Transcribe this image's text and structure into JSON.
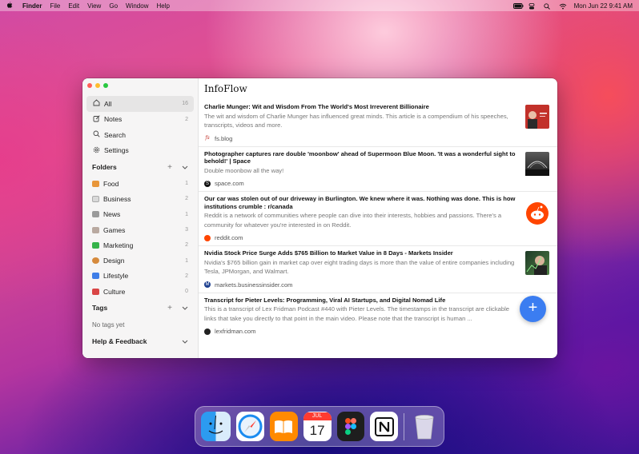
{
  "menubar": {
    "app_name": "Finder",
    "menus": [
      "File",
      "Edit",
      "View",
      "Go",
      "Window",
      "Help"
    ],
    "clock": "Mon Jun 22  9:41 AM"
  },
  "sidebar": {
    "nav": [
      {
        "label": "All",
        "count": "16",
        "icon": "home-icon"
      },
      {
        "label": "Notes",
        "count": "2",
        "icon": "notes-icon"
      },
      {
        "label": "Search",
        "count": "",
        "icon": "search-icon"
      },
      {
        "label": "Settings",
        "count": "",
        "icon": "gear-icon"
      }
    ],
    "folders_heading": "Folders",
    "folders": [
      {
        "label": "Food",
        "count": "1",
        "color": "#e8963a"
      },
      {
        "label": "Business",
        "count": "2",
        "color": "#c9c9c9"
      },
      {
        "label": "News",
        "count": "1",
        "color": "#9a9a9a"
      },
      {
        "label": "Games",
        "count": "3",
        "color": "#b9a9a0"
      },
      {
        "label": "Marketing",
        "count": "2",
        "color": "#35b34a"
      },
      {
        "label": "Design",
        "count": "1",
        "color": "#d68a3c"
      },
      {
        "label": "Lifestyle",
        "count": "2",
        "color": "#3f7ee8"
      },
      {
        "label": "Culture",
        "count": "0",
        "color": "#d94545"
      }
    ],
    "tags_heading": "Tags",
    "no_tags": "No tags yet",
    "help_heading": "Help & Feedback"
  },
  "content": {
    "title": "InfoFlow",
    "articles": [
      {
        "title": "Charlie Munger: Wit and Wisdom From The World's Most Irreverent Billionaire",
        "description": "The wit and wisdom of Charlie Munger has influenced great minds. This article is a compendium of his speeches, transcripts, videos and more.",
        "source": "fs.blog",
        "thumb_color": "#c2312a"
      },
      {
        "title": "Photographer captures rare double 'moonbow' ahead of Supermoon Blue Moon. 'It was a wonderful sight to behold!' | Space",
        "description": "Double moonbow all the way!",
        "source": "space.com",
        "thumb_color": "#3c3c3c"
      },
      {
        "title": "Our car was stolen out of our driveway in Burlington. We knew where it was. Nothing was done. This is how institutions crumble : r/canada",
        "description": "Reddit is a network of communities where people can dive into their interests, hobbies and passions. There's a community for whatever you're interested in on Reddit.",
        "source": "reddit.com",
        "thumb_color": "#ff4500"
      },
      {
        "title": "Nvidia Stock Price Surge Adds $765 Billion to Market Value in 8 Days - Markets Insider",
        "description": "Nvidia's $765 billion gain in market cap over eight trading days is more than the value of entire companies including Tesla, JPMorgan, and Walmart.",
        "source": "markets.businessinsider.com",
        "thumb_color": "#2e5d3a"
      },
      {
        "title": "Transcript for Pieter Levels: Programming, Viral AI Startups, and Digital Nomad Life",
        "description": "This is a transcript of Lex Fridman Podcast #440 with Pieter Levels. The timestamps in the transcript are clickable links that take you directly to that point in the main video. Please note that the transcript is human ...",
        "source": "lexfridman.com",
        "thumb_color": ""
      }
    ],
    "fab_label": "+"
  },
  "dock": {
    "apps": [
      "Finder",
      "Safari",
      "Books",
      "Calendar",
      "Figma",
      "Notion",
      "Trash"
    ],
    "calendar_month": "JUL",
    "calendar_day": "17"
  }
}
